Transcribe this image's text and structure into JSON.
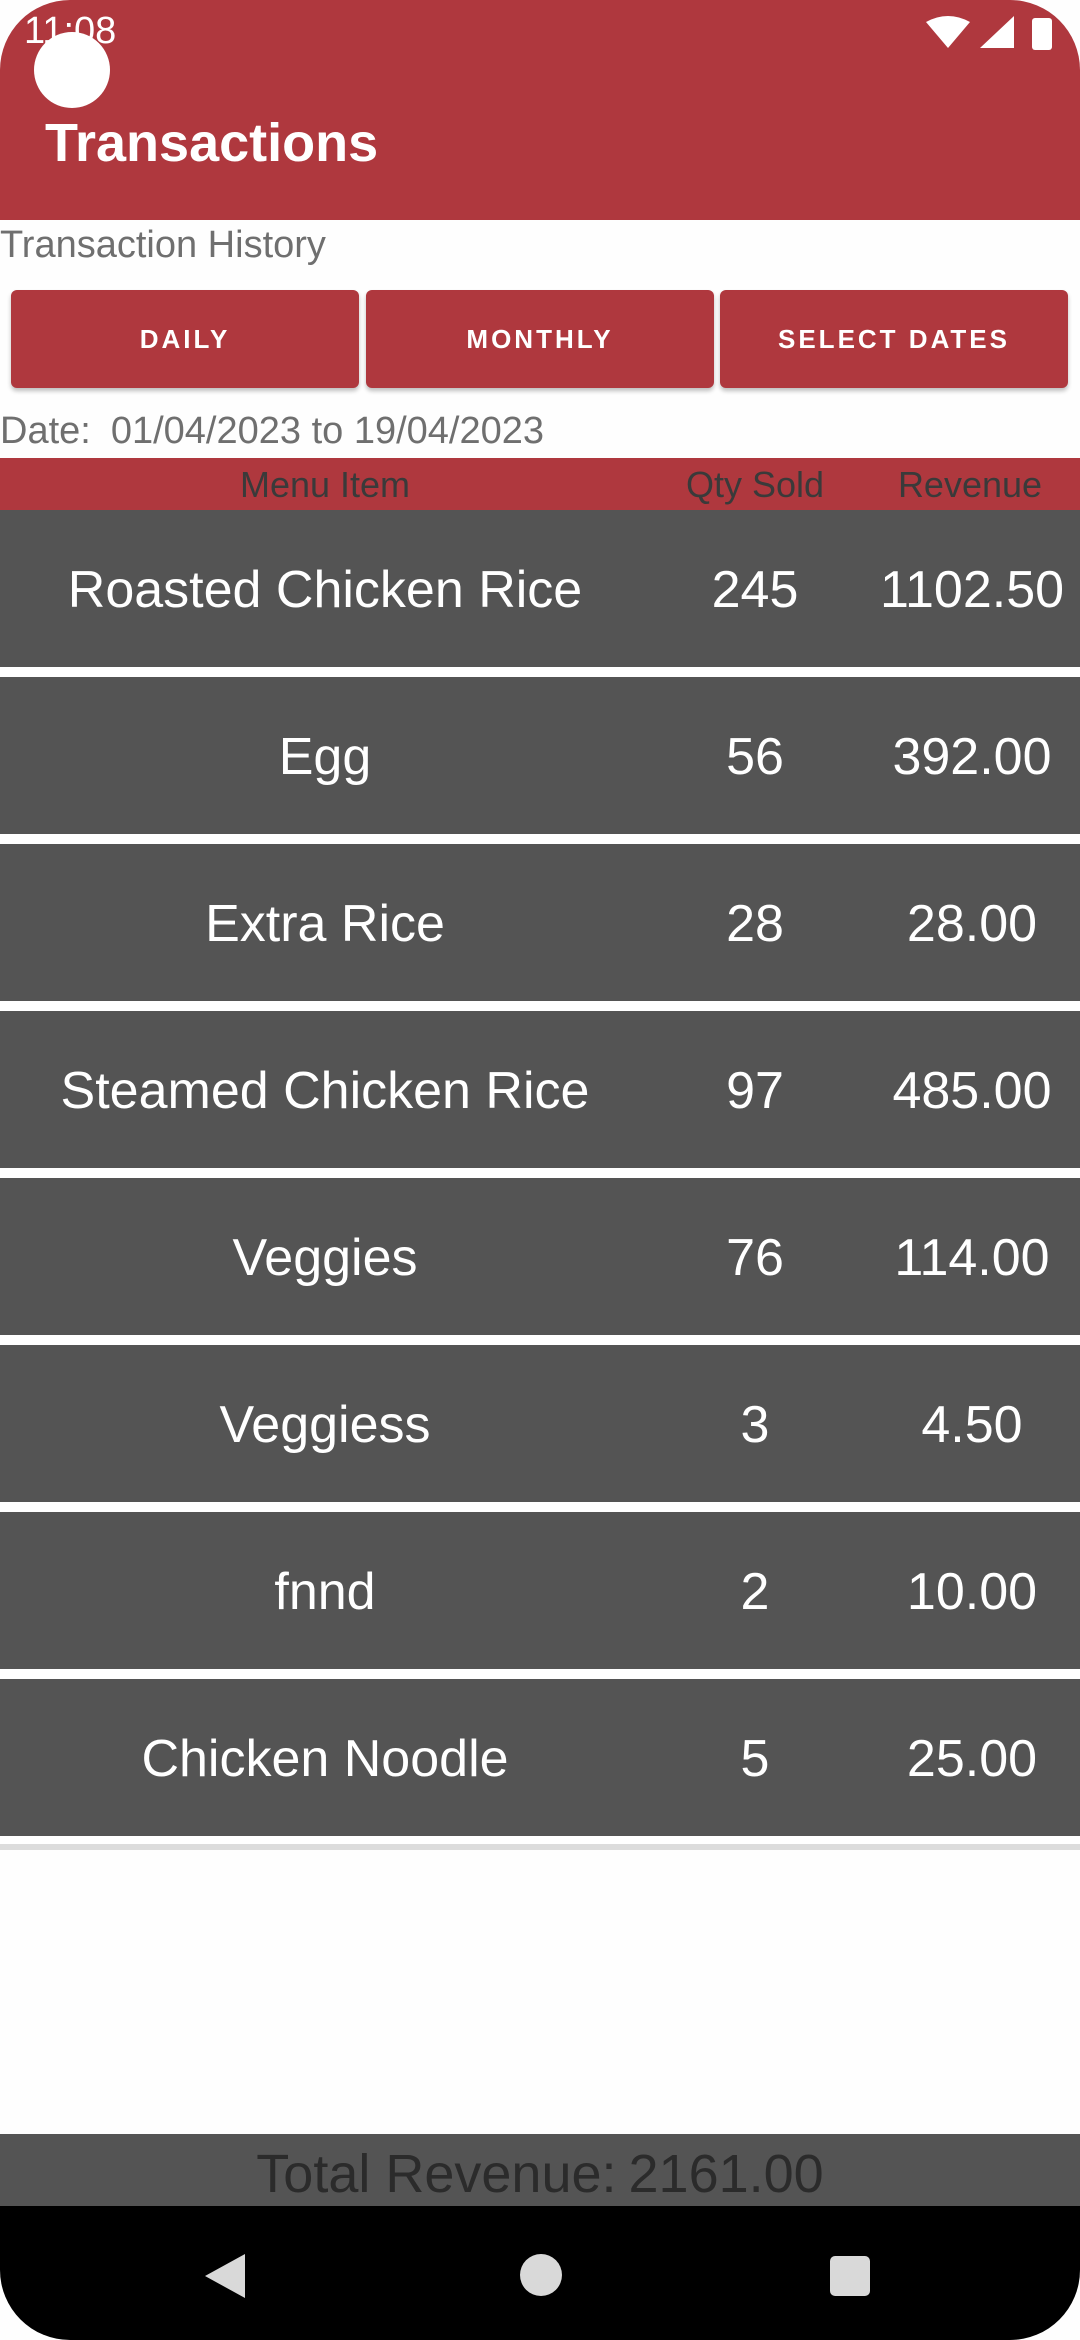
{
  "status_bar": {
    "time": "11:08",
    "icons": [
      "wifi-icon",
      "signal-icon",
      "battery-icon"
    ]
  },
  "app_bar": {
    "title": "Transactions",
    "color": "#af383e"
  },
  "section_title": "Transaction History",
  "filters": {
    "daily": "DAILY",
    "monthly": "MONTHLY",
    "select_dates": "SELECT DATES"
  },
  "date_range": {
    "label": "Date:",
    "value": "01/04/2023 to 19/04/2023"
  },
  "table": {
    "headers": {
      "item": "Menu Item",
      "qty": "Qty Sold",
      "revenue": "Revenue"
    },
    "rows": [
      {
        "item": "Roasted Chicken Rice",
        "qty": "245",
        "revenue": "1102.50"
      },
      {
        "item": "Egg",
        "qty": "56",
        "revenue": "392.00"
      },
      {
        "item": "Extra Rice",
        "qty": "28",
        "revenue": "28.00"
      },
      {
        "item": "Steamed Chicken Rice",
        "qty": "97",
        "revenue": "485.00"
      },
      {
        "item": "Veggies",
        "qty": "76",
        "revenue": "114.00"
      },
      {
        "item": "Veggiess",
        "qty": "3",
        "revenue": "4.50"
      },
      {
        "item": "fnnd",
        "qty": "2",
        "revenue": "10.00"
      },
      {
        "item": "Chicken Noodle",
        "qty": "5",
        "revenue": "25.00"
      }
    ]
  },
  "total": {
    "label": "Total Revenue:",
    "value": "2161.00"
  },
  "nav_bar": {
    "icons": [
      "back-icon",
      "home-icon",
      "recents-icon"
    ]
  }
}
